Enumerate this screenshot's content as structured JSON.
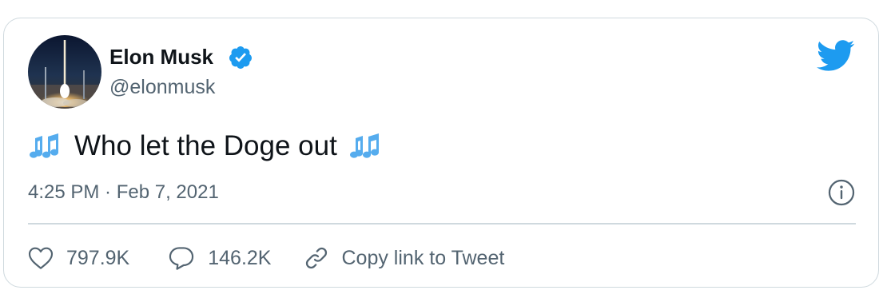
{
  "author": {
    "name": "Elon Musk",
    "handle": "@elonmusk",
    "verified": true,
    "avatar_icon": "rocket-launch-avatar"
  },
  "tweet": {
    "text": "Who let the Doge out",
    "leading_icon": "musical-notes-icon",
    "trailing_icon": "musical-notes-icon",
    "timestamp": "4:25 PM · Feb 7, 2021"
  },
  "actions": {
    "like_count": "797.9K",
    "reply_count": "146.2K",
    "copy_link_label": "Copy link to Tweet"
  },
  "icons": {
    "brand": "twitter-bird-icon",
    "info": "info-icon",
    "like": "heart-icon",
    "reply": "speech-bubble-icon",
    "link": "link-icon"
  },
  "colors": {
    "brand_blue": "#1d9bf0",
    "secondary_text": "#536471",
    "primary_text": "#0f1419",
    "border": "#cfd9de"
  }
}
